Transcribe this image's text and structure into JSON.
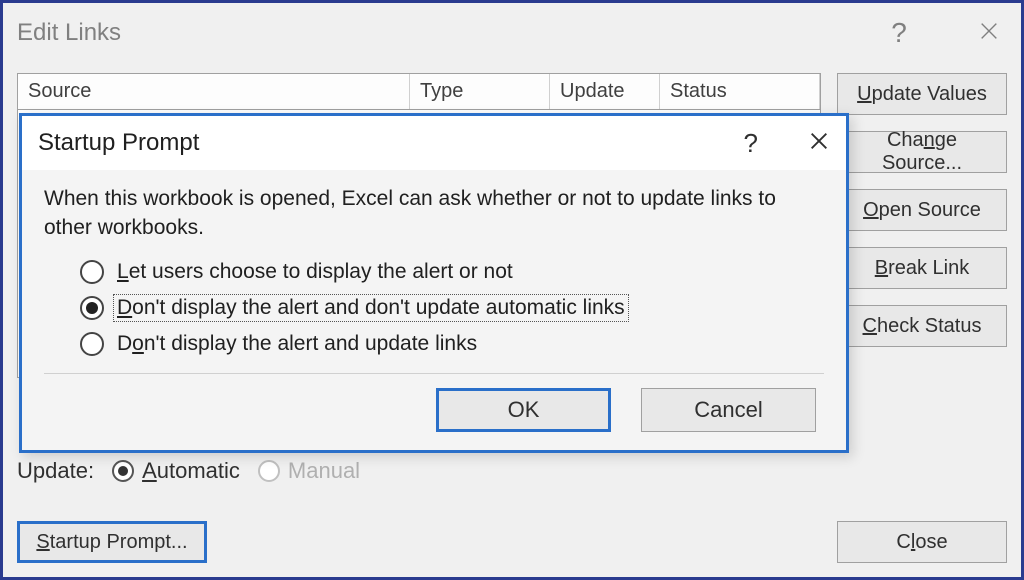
{
  "outer": {
    "title": "Edit Links",
    "help_glyph": "?",
    "columns": {
      "source": "Source",
      "type": "Type",
      "update": "Update",
      "status": "Status"
    },
    "update_label": "Update:",
    "update_options": {
      "automatic": "Automatic",
      "manual": "Manual"
    },
    "buttons": {
      "update_values": "Update Values",
      "change_source": "Change Source...",
      "open_source": "Open Source",
      "break_link": "Break Link",
      "check_status": "Check Status",
      "startup_prompt": "Startup Prompt...",
      "close": "Close"
    }
  },
  "inner": {
    "title": "Startup Prompt",
    "help_glyph": "?",
    "message": "When this workbook is opened, Excel can ask whether or not to update links to other workbooks.",
    "options": {
      "let_users": "Let users choose to display the alert or not",
      "dont_display_dont_update": "Don't display the alert and don't update automatic links",
      "dont_display_update": "Don't display the alert and update links"
    },
    "selected": "dont_display_dont_update",
    "buttons": {
      "ok": "OK",
      "cancel": "Cancel"
    }
  }
}
